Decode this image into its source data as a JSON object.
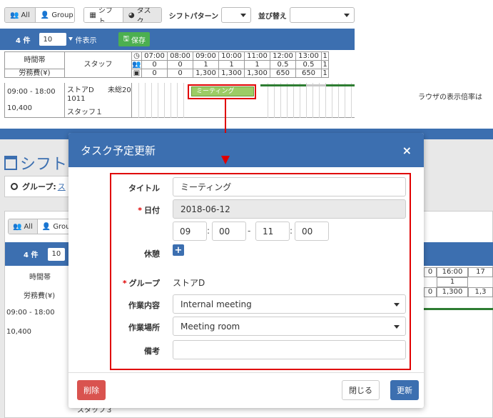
{
  "top": {
    "view_all": "All",
    "view_group": "Group",
    "view_shift": "シフト",
    "view_task": "タスク",
    "shift_pattern_label": "シフトパターン",
    "sort_label": "並び替え",
    "count": "4 件",
    "per_page_value": "10",
    "per_page_label": "件表示",
    "save_label": "保存",
    "header_timezone": "時間帯",
    "header_labor_cost": "労務費(¥)",
    "header_staff": "スタッフ",
    "time_columns": [
      "07:00",
      "08:00",
      "09:00",
      "10:00",
      "11:00",
      "12:00",
      "13:00",
      "1"
    ],
    "row_people": [
      "0",
      "0",
      "1",
      "1",
      "1",
      "0.5",
      "0.5",
      "1"
    ],
    "row_cost": [
      "0",
      "0",
      "1,300",
      "1,300",
      "1,300",
      "650",
      "650",
      "1"
    ],
    "staff_row": {
      "time": "09:00 - 18:00",
      "cost": "10,400",
      "store": "ストアD",
      "status": "未総20",
      "code": "1011",
      "name": "スタッフ１"
    },
    "task_bar_label": "ミーティング"
  },
  "background": {
    "title": "シフト",
    "group_label": "グループ:",
    "group_value": "ス",
    "btn_all": "All",
    "btn_group": "Grou",
    "count": "4 件",
    "per_page": "10",
    "header_timezone": "時間帯",
    "header_labor_cost": "労務費(¥)",
    "staff_time": "09:00 - 18:00",
    "staff_cost": "10,400",
    "right_text": "ラウザの表示倍率は",
    "right_time_a": "0",
    "right_time_b": "16:00",
    "right_time_c": "17",
    "right_people": "1",
    "right_cost_a": "0",
    "right_cost_b": "1,300",
    "right_cost_c": "1,3",
    "staff3": "スタッフ３"
  },
  "modal": {
    "title": "タスク予定更新",
    "close_symbol": "×",
    "fields": {
      "title_label": "タイトル",
      "title_value": "ミーティング",
      "date_label": "日付",
      "date_value": "2018-06-12",
      "start_hour": "09",
      "start_min": "00",
      "end_hour": "11",
      "end_min": "00",
      "time_colon": ":",
      "time_dash": "-",
      "break_label": "休憩",
      "group_label": "グループ",
      "group_value": "ストアD",
      "work_label": "作業内容",
      "work_value": "Internal meeting",
      "place_label": "作業場所",
      "place_value": "Meeting room",
      "note_label": "備考",
      "note_value": ""
    },
    "required_mark": "*",
    "buttons": {
      "delete": "削除",
      "close": "閉じる",
      "update": "更新"
    }
  },
  "colors": {
    "primary": "#3c6fb0",
    "danger": "#d9534f",
    "annotation_red": "#e00000",
    "task_green": "#9ccc65",
    "save_green": "#4caf50"
  }
}
